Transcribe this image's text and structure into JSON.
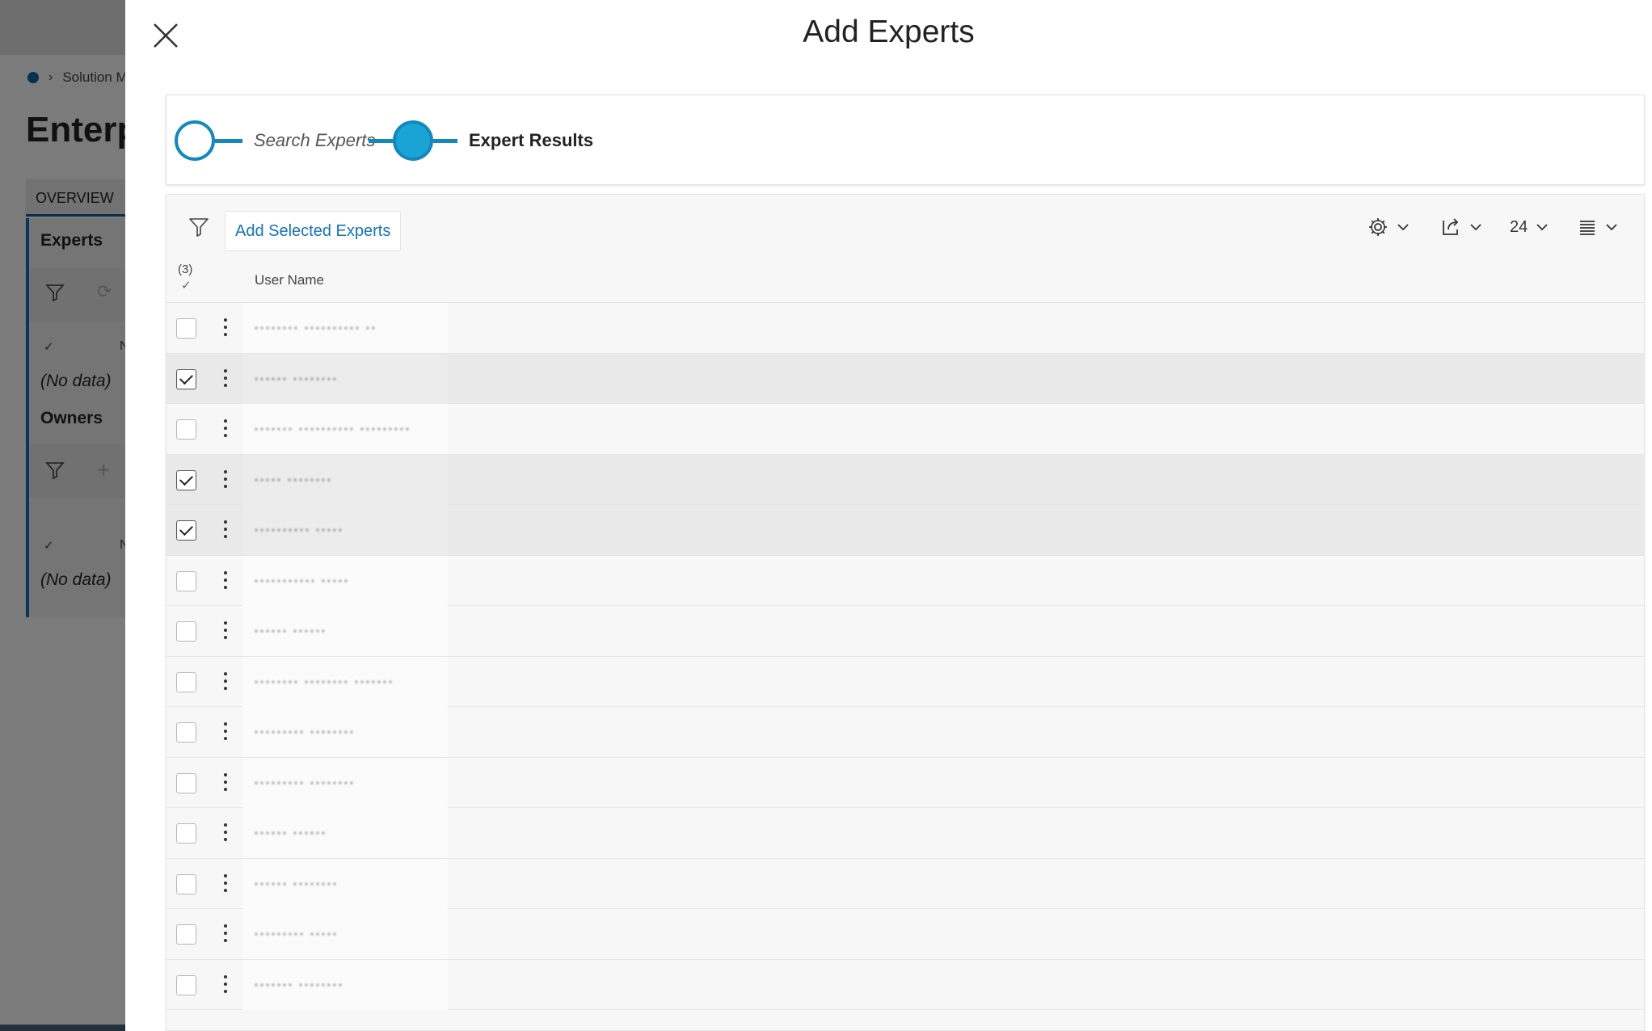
{
  "background": {
    "breadcrumb": "Solution M",
    "title": "Enterp",
    "tab_overview": "OVERVIEW",
    "section_experts": "Experts",
    "section_owners": "Owners",
    "no_data_1": "(No data)",
    "no_data_2": "(No data)",
    "col_n_1": "N",
    "col_n_2": "N"
  },
  "drawer": {
    "title": "Add Experts",
    "steps": [
      {
        "label": "Search Experts",
        "state": "complete"
      },
      {
        "label": "Expert Results",
        "state": "active"
      }
    ],
    "toolbar": {
      "add_selected_label": "Add Selected Experts",
      "page_size": "24"
    },
    "grid": {
      "selected_count": "(3)",
      "column_user_name": "User Name",
      "rows": [
        {
          "name": "········ ·········· ··",
          "checked": false
        },
        {
          "name": "······ ········",
          "checked": true
        },
        {
          "name": "······· ·········· ·········",
          "checked": false
        },
        {
          "name": "····· ········",
          "checked": true
        },
        {
          "name": "·········· ·····",
          "checked": true
        },
        {
          "name": "··········· ·····",
          "checked": false
        },
        {
          "name": "······ ······",
          "checked": false
        },
        {
          "name": "········ ········ ·······",
          "checked": false
        },
        {
          "name": "········· ········",
          "checked": false
        },
        {
          "name": "········· ········",
          "checked": false
        },
        {
          "name": "······ ······",
          "checked": false
        },
        {
          "name": "······ ········",
          "checked": false
        },
        {
          "name": "········· ·····",
          "checked": false
        },
        {
          "name": "······· ········",
          "checked": false
        }
      ]
    }
  },
  "colors": {
    "accent": "#1488bd",
    "accent_fill": "#1aa4d6",
    "link": "#1672b8"
  }
}
